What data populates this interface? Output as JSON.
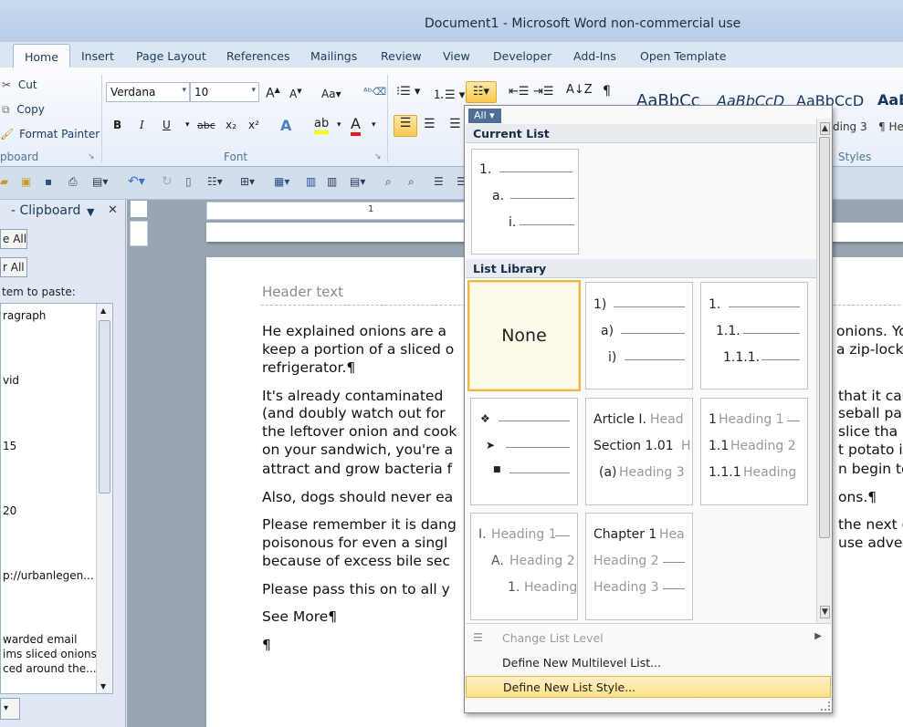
{
  "window": {
    "title": "Document1  -  Microsoft Word non-commercial use"
  },
  "tabs": [
    "Home",
    "Insert",
    "Page Layout",
    "References",
    "Mailings",
    "Review",
    "View",
    "Developer",
    "Add-Ins",
    "Open Template"
  ],
  "clipboard_group": {
    "cut": "Cut",
    "copy": "Copy",
    "format_painter": "Format Painter",
    "label": "pboard"
  },
  "font_group": {
    "font": "Verdana",
    "size": "10",
    "label": "Font",
    "bold": "B",
    "italic": "I",
    "underline": "U",
    "strike": "abc",
    "sub": "x₂",
    "sup": "x²"
  },
  "paragraph_group": {
    "pilcrow": "¶"
  },
  "styles_group": {
    "label": "Styles",
    "previews": [
      "AaBbCc",
      "AaBbCcD",
      "AaBbCcD",
      "AaB"
    ],
    "names": [
      "ding 3",
      "¶ He"
    ]
  },
  "clipboard_pane": {
    "title": "- Clipboard",
    "paste_all": "e All",
    "clear_all": "r All",
    "prompt": "tem to paste:",
    "items": [
      "ragraph",
      "vid",
      "15",
      "20",
      "p://urbanlegen...",
      "warded email",
      "ims sliced onions",
      "ced around the..."
    ]
  },
  "ruler": {
    "mark": "1"
  },
  "document": {
    "header": "Header text",
    "paragraphs": [
      [
        "He explained onions are a",
        "onions. Yo"
      ],
      [
        "keep a portion of a sliced o",
        "a zip-lock"
      ],
      [
        "refrigerator.¶",
        ""
      ],
      [
        "It's already contaminated",
        "that it ca"
      ],
      [
        "(and doubly watch out for",
        "seball par"
      ],
      [
        "the leftover onion and cook",
        "slice tha"
      ],
      [
        "on your sandwich, you're a",
        "t potato i"
      ],
      [
        "attract and grow bacteria f",
        "n begin to"
      ],
      [
        "Also, dogs should never ea",
        "ons.¶"
      ],
      [
        "Please remember it is dang",
        "the next d"
      ],
      [
        "poisonous for even a singl",
        "use adver"
      ],
      [
        "because of excess bile sec",
        ""
      ],
      [
        "Please pass this on to all y",
        ""
      ],
      [
        "See More¶",
        ""
      ],
      [
        "¶",
        ""
      ]
    ]
  },
  "list_menu": {
    "filter": "All",
    "current_list_header": "Current List",
    "library_header": "List Library",
    "current": [
      "1.",
      "a.",
      "i."
    ],
    "none_label": "None",
    "lib": {
      "numeric_paren": [
        "1)",
        "a)",
        "i)"
      ],
      "legal": [
        "1.",
        "1.1.",
        "1.1.1."
      ],
      "bullets": [
        "❖",
        "➤",
        "■"
      ],
      "article": [
        "Article I.",
        "Head",
        "Section 1.01",
        "H",
        "(a)",
        "Heading 3"
      ],
      "heading_num": [
        "1",
        "Heading 1",
        "1.1",
        "Heading 2",
        "1.1.1",
        "Heading"
      ],
      "outline": [
        "I.",
        "Heading 1",
        "A.",
        "Heading 2",
        "1.",
        "Heading"
      ],
      "chapter": [
        "Chapter 1",
        "Hea",
        "Heading 2",
        "Heading 3"
      ]
    },
    "items": {
      "change_level": "Change List Level",
      "define_multilevel": "Define New Multilevel List...",
      "define_style": "Define New List Style..."
    }
  }
}
